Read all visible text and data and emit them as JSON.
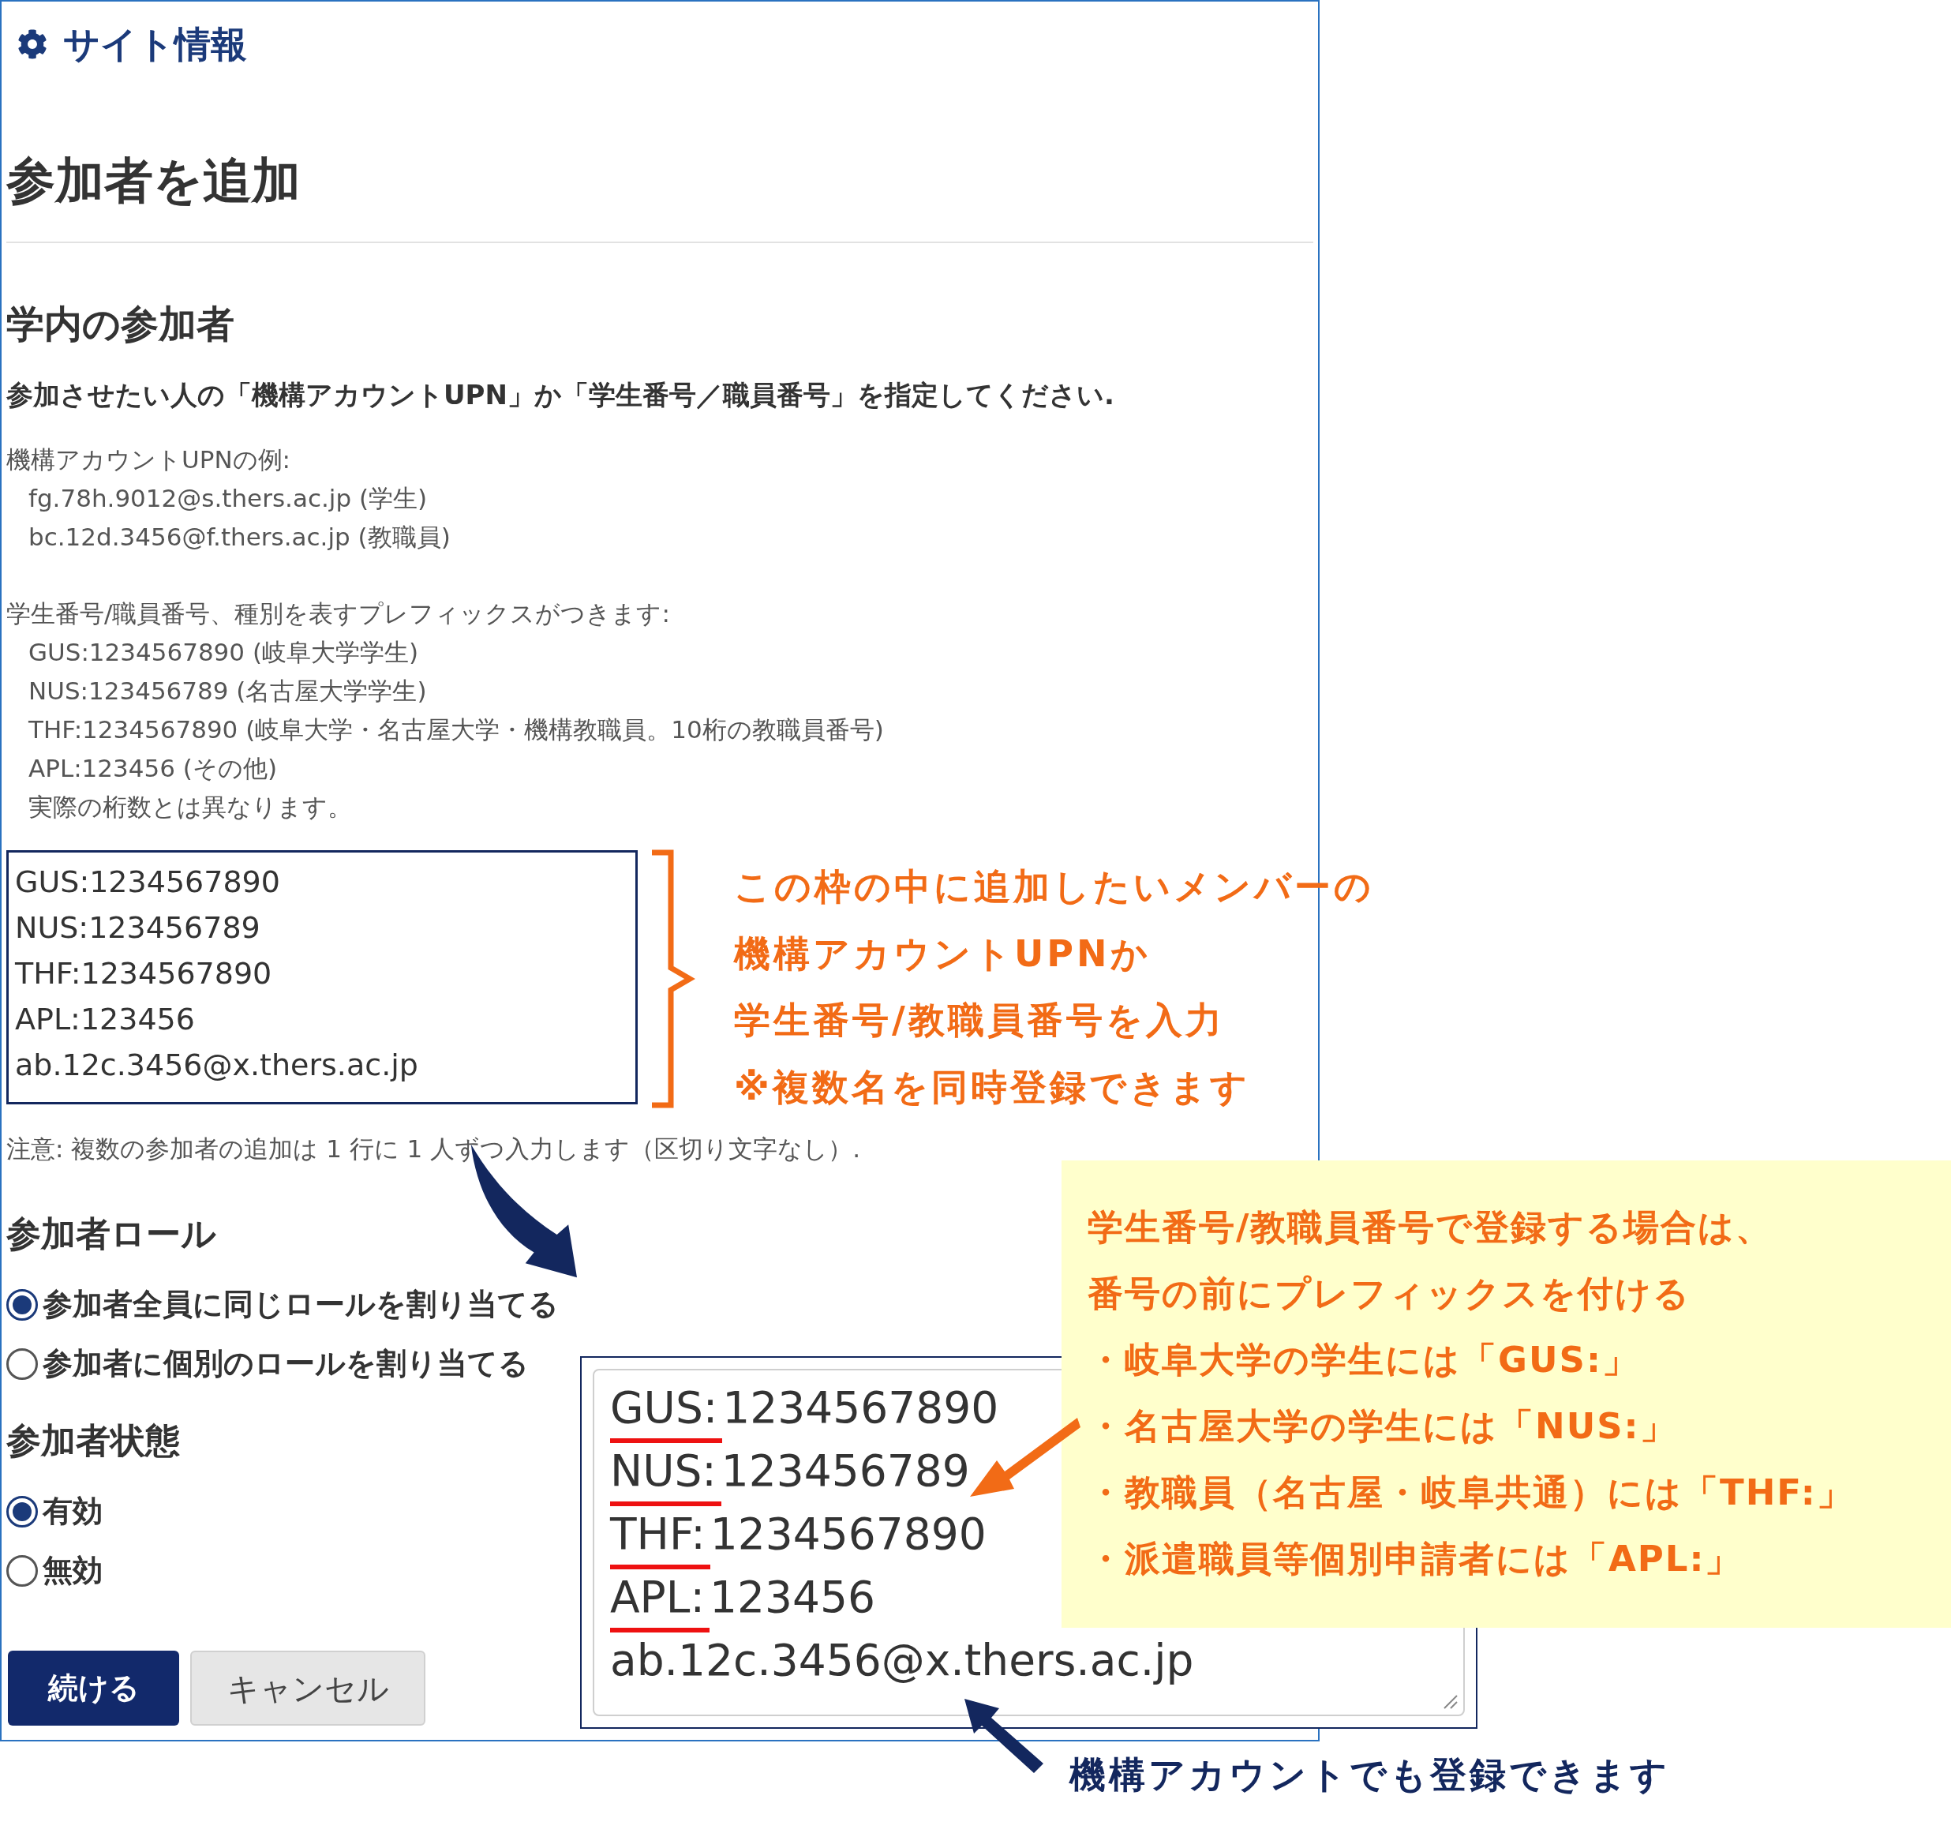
{
  "header": {
    "title": "サイト情報"
  },
  "page_title": "参加者を追加",
  "section": {
    "title": "学内の参加者",
    "instruction": "参加させたい人の「機構アカウントUPN」か「学生番号／職員番号」を指定してください.",
    "help_groups": [
      {
        "label": "機構アカウントUPNの例:",
        "lines": [
          "fg.78h.9012@s.thers.ac.jp (学生)",
          "bc.12d.3456@f.thers.ac.jp (教職員)"
        ]
      },
      {
        "label": "学生番号/職員番号、種別を表すプレフィックスがつきます:",
        "lines": [
          "GUS:1234567890 (岐阜大学学生)",
          "NUS:123456789 (名古屋大学学生)",
          "THF:1234567890 (岐阜大学・名古屋大学・機構教職員。10桁の教職員番号)",
          "APL:123456 (その他)",
          "実際の桁数とは異なります。"
        ]
      }
    ]
  },
  "participants_field": {
    "lines": [
      "GUS:1234567890",
      "NUS:123456789",
      "THF:1234567890",
      "APL:123456",
      "ab.12c.3456@x.thers.ac.jp"
    ]
  },
  "note": "注意: 複数の参加者の追加は 1 行に 1 人ずつ入力します（区切り文字なし）.",
  "role": {
    "title": "参加者ロール",
    "options": [
      {
        "label": "参加者全員に同じロールを割り当てる",
        "selected": true
      },
      {
        "label": "参加者に個別のロールを割り当てる",
        "selected": false
      }
    ]
  },
  "status": {
    "title": "参加者状態",
    "options": [
      {
        "label": "有効",
        "selected": true
      },
      {
        "label": "無効",
        "selected": false
      }
    ]
  },
  "buttons": [
    {
      "label": "続ける",
      "kind": "primary"
    },
    {
      "label": "キャンセル",
      "kind": "secondary"
    }
  ],
  "annotations": {
    "input_callout": {
      "lines": [
        "この枠の中に追加したいメンバーの",
        "機構アカウントUPNか",
        "学生番号/教職員番号を入力",
        "※複数名を同時登録できます"
      ]
    },
    "zoomed_field": {
      "lines": [
        {
          "prefix": "GUS:",
          "rest": "1234567890"
        },
        {
          "prefix": "NUS:",
          "rest": "123456789"
        },
        {
          "prefix": "THF:",
          "rest": "1234567890"
        },
        {
          "prefix": "APL:",
          "rest": "123456"
        },
        {
          "rest": "ab.12c.3456@x.thers.ac.jp"
        }
      ]
    },
    "prefix_callout": {
      "lines": [
        "学生番号/教職員番号で登録する場合は、",
        "番号の前にプレフィックスを付ける",
        "・岐阜大学の学生には「GUS:」",
        "・名古屋大学の学生には「NUS:」",
        "・教職員（名古屋・岐阜共通）には「THF:」",
        "・派遣職員等個別申請者には「APL:」"
      ]
    },
    "account_caption": "機構アカウントでも登録できます"
  }
}
